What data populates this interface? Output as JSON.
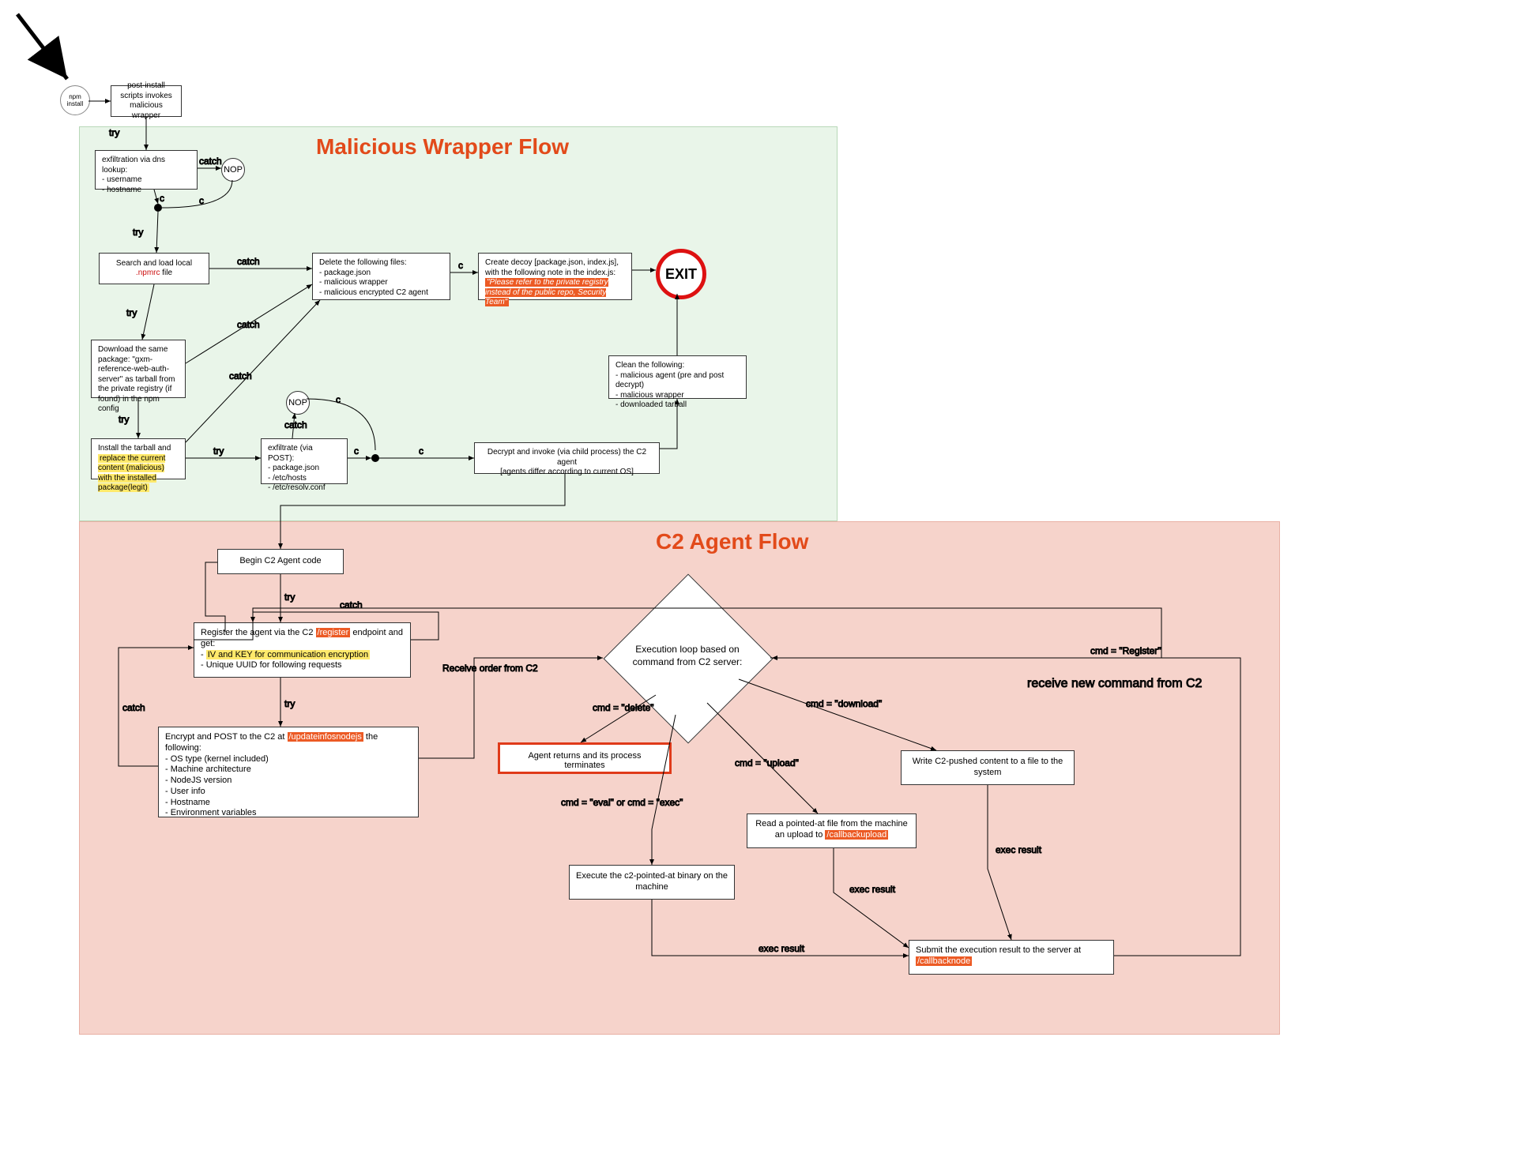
{
  "chart_data": {
    "type": "flowchart",
    "sections": [
      {
        "id": "wrapper",
        "title": "Malicious Wrapper Flow",
        "color": "#e9f5e9"
      },
      {
        "id": "c2",
        "title": "C2 Agent Flow",
        "color": "#f6d3cb"
      }
    ],
    "nodes": [
      {
        "id": "start",
        "kind": "circle",
        "label": "npm install"
      },
      {
        "id": "postinstall",
        "kind": "box",
        "label": "post-install scripts invokes malicious wrapper"
      },
      {
        "id": "exfil_dns",
        "kind": "box",
        "label": "exfiltration via dns lookup:",
        "bullets": [
          "username",
          "hostname"
        ]
      },
      {
        "id": "nop1",
        "kind": "nop",
        "label": "NOP"
      },
      {
        "id": "dot1",
        "kind": "junction"
      },
      {
        "id": "search_npmrc",
        "kind": "box",
        "label": "Search and load local",
        "highlight": ".npmrc",
        "highlight_style": "text-red",
        "suffix": " file"
      },
      {
        "id": "download_pkg",
        "kind": "box",
        "label": "Download the same package: \"gxm-reference-web-auth-server\" as tarball from the private registry (if found) in the npm config"
      },
      {
        "id": "install_tarball",
        "kind": "box",
        "label": "Install the tarball and ",
        "highlight": "replace the current content (malicious) with the installed package(legit)",
        "highlight_style": "yellow"
      },
      {
        "id": "nop2",
        "kind": "nop",
        "label": "NOP"
      },
      {
        "id": "exfil_post",
        "kind": "box",
        "label": "exfiltrate (via POST):",
        "bullets": [
          "package.json",
          "/etc/hosts",
          "/etc/resolv.conf"
        ]
      },
      {
        "id": "dot2",
        "kind": "junction"
      },
      {
        "id": "delete_files",
        "kind": "box",
        "label": "Delete the following files:",
        "bullets": [
          "package.json",
          "malicious wrapper",
          "malicious encrypted C2 agent"
        ]
      },
      {
        "id": "decoy",
        "kind": "box",
        "label": "Create decoy [package.json, index.js], with the following note in the index.js:",
        "highlight": "\"Please refer to the private registry instead of the public repo, Security Team\"",
        "highlight_style": "orange"
      },
      {
        "id": "exit",
        "kind": "exit-circle",
        "label": "EXIT"
      },
      {
        "id": "clean",
        "kind": "box",
        "label": "Clean the following:",
        "bullets": [
          "malicious agent (pre and post decrypt)",
          "malicious wrapper",
          "downloaded tarball"
        ]
      },
      {
        "id": "decrypt",
        "kind": "box",
        "label": "Decrypt and invoke (via child process) the C2 agent",
        "subnote": "[agents differ according to current OS]"
      },
      {
        "id": "begin_c2",
        "kind": "box",
        "label": "Begin C2 Agent code"
      },
      {
        "id": "register",
        "kind": "box",
        "label": "Register the agent via the C2 ",
        "inline_hl": "/register",
        "suffix": " endpoint and get:",
        "bullets_hl": [
          "IV and KEY for communication encryption"
        ],
        "bullets": [
          "Unique UUID for following requests"
        ]
      },
      {
        "id": "encrypt_post",
        "kind": "box",
        "label": "Encrypt and POST to the C2 at ",
        "inline_hl": "/updateinfosnodejs",
        "suffix": " the following:",
        "bullets": [
          "OS type (kernel included)",
          "Machine architecture",
          "NodeJS version",
          "User info",
          "Hostname",
          "Environment variables"
        ]
      },
      {
        "id": "loop",
        "kind": "diamond",
        "label": "Execution loop based on command from C2 server:"
      },
      {
        "id": "delete_cmd",
        "kind": "redbox",
        "label": "Agent returns and its process terminates"
      },
      {
        "id": "exec_cmd",
        "kind": "box",
        "label": "Execute the c2-pointed-at binary on the machine"
      },
      {
        "id": "upload_cmd",
        "kind": "box",
        "label": "Read a pointed-at file from the machine an upload to ",
        "inline_hl": "/callbackupload"
      },
      {
        "id": "download_cmd",
        "kind": "box",
        "label": "Write C2-pushed content to a file to the system"
      },
      {
        "id": "submit",
        "kind": "box",
        "label": "Submit the execution result to the server at ",
        "inline_hl": "/callbacknode"
      }
    ],
    "edges": [
      {
        "from": "start",
        "to": "postinstall"
      },
      {
        "from": "postinstall",
        "to": "exfil_dns",
        "label": "try"
      },
      {
        "from": "exfil_dns",
        "to": "nop1",
        "label": "catch"
      },
      {
        "from": "nop1",
        "to": "dot1",
        "label": "c"
      },
      {
        "from": "exfil_dns",
        "to": "dot1",
        "label": "c"
      },
      {
        "from": "dot1",
        "to": "search_npmrc",
        "label": "try"
      },
      {
        "from": "search_npmrc",
        "to": "delete_files",
        "label": "catch"
      },
      {
        "from": "search_npmrc",
        "to": "download_pkg",
        "label": "try"
      },
      {
        "from": "download_pkg",
        "to": "delete_files",
        "label": "catch"
      },
      {
        "from": "download_pkg",
        "to": "install_tarball",
        "label": "try"
      },
      {
        "from": "install_tarball",
        "to": "delete_files",
        "label": "catch"
      },
      {
        "from": "install_tarball",
        "to": "exfil_post",
        "label": "try"
      },
      {
        "from": "exfil_post",
        "to": "nop2",
        "label": "catch"
      },
      {
        "from": "nop2",
        "to": "dot2",
        "label": "c"
      },
      {
        "from": "exfil_post",
        "to": "dot2",
        "label": "c"
      },
      {
        "from": "dot2",
        "to": "decrypt",
        "label": "c"
      },
      {
        "from": "delete_files",
        "to": "decoy",
        "label": "c"
      },
      {
        "from": "decoy",
        "to": "exit",
        "label": "c"
      },
      {
        "from": "decrypt",
        "to": "clean",
        "label": ""
      },
      {
        "from": "clean",
        "to": "exit",
        "label": ""
      },
      {
        "from": "decrypt",
        "to": "begin_c2",
        "label": ""
      },
      {
        "from": "begin_c2",
        "to": "register",
        "label": "try"
      },
      {
        "from": "register",
        "to": "encrypt_post",
        "label": "try"
      },
      {
        "from": "register",
        "to": "begin_c2",
        "label": "catch (loop)"
      },
      {
        "from": "encrypt_post",
        "to": "begin_c2",
        "label": "catch (loop)"
      },
      {
        "from": "encrypt_post",
        "to": "loop",
        "label": "Receive order from C2"
      },
      {
        "from": "loop",
        "to": "delete_cmd",
        "label": "cmd = \"delete\""
      },
      {
        "from": "loop",
        "to": "exec_cmd",
        "label": "cmd = \"eval\" or cmd = \"exec\""
      },
      {
        "from": "loop",
        "to": "upload_cmd",
        "label": "cmd = \"upload\""
      },
      {
        "from": "loop",
        "to": "download_cmd",
        "label": "cmd = \"download\""
      },
      {
        "from": "loop",
        "to": "register",
        "label": "cmd = \"Register\""
      },
      {
        "from": "exec_cmd",
        "to": "submit",
        "label": "exec result"
      },
      {
        "from": "upload_cmd",
        "to": "submit",
        "label": "exec result"
      },
      {
        "from": "download_cmd",
        "to": "submit",
        "label": "exec result"
      },
      {
        "from": "submit",
        "to": "loop",
        "label": "receive new command from C2"
      }
    ]
  },
  "titles": {
    "wrapper": "Malicious Wrapper Flow",
    "c2": "C2 Agent Flow"
  },
  "start": {
    "label": "npm\ninstall"
  },
  "postinstall": {
    "text": "post-install scripts invokes malicious wrapper"
  },
  "exfil_dns": {
    "title": "exfiltration via dns lookup:",
    "b1": "- username",
    "b2": "- hostname"
  },
  "nop1": {
    "text": "NOP"
  },
  "search_npmrc": {
    "pre": "Search and load local ",
    "hl": ".npmrc",
    "post": " file"
  },
  "download_pkg": {
    "text": "Download the same package: \"gxm-reference-web-auth-server\" as tarball from the private registry (if found) in the npm config"
  },
  "install_tarball": {
    "pre": "Install the tarball and ",
    "hl": "replace the current content (malicious) with the installed package(legit)"
  },
  "nop2": {
    "text": "NOP"
  },
  "exfil_post": {
    "title": "exfiltrate (via POST):",
    "b1": "- package.json",
    "b2": "- /etc/hosts",
    "b3": "- /etc/resolv.conf"
  },
  "delete_files": {
    "title": "Delete the following files:",
    "b1": "- package.json",
    "b2": "- malicious wrapper",
    "b3": "- malicious encrypted C2 agent"
  },
  "decoy": {
    "title": "Create decoy [package.json, index.js], with the following note in the index.js:",
    "hl": "\"Please refer to the private registry instead of the public repo, Security Team\""
  },
  "exit": {
    "text": "EXIT"
  },
  "clean": {
    "title": "Clean the following:",
    "b1": "- malicious agent (pre and post decrypt)",
    "b2": "- malicious wrapper",
    "b3": "- downloaded tarball"
  },
  "decrypt": {
    "line1": "Decrypt and invoke (via child process) the C2 agent",
    "line2": "[agents differ according to current OS]"
  },
  "begin_c2": {
    "text": "Begin C2 Agent code"
  },
  "register": {
    "pre": "Register the agent via the C2 ",
    "hl": "/register",
    "mid": " endpoint and get:",
    "b1_hl": "IV and KEY for communication encryption",
    "b2": "- Unique UUID for following requests"
  },
  "encrypt_post": {
    "pre": "Encrypt and POST to the C2 at ",
    "hl": "/updateinfosnodejs",
    "mid": " the following:",
    "b1": "- OS type (kernel included)",
    "b2": "- Machine architecture",
    "b3": "- NodeJS version",
    "b4": "- User info",
    "b5": "- Hostname",
    "b6": "- Environment variables"
  },
  "loop": {
    "line1": "Execution loop based on",
    "line2": "command from C2 server:"
  },
  "delete_cmd": {
    "text": "Agent returns and its process terminates"
  },
  "exec_cmd": {
    "text": "Execute the c2-pointed-at binary on the machine"
  },
  "upload_cmd": {
    "pre": "Read a pointed-at file from the machine an upload to ",
    "hl": "/callbackupload"
  },
  "download_cmd": {
    "text": "Write C2-pushed content to a file to the system"
  },
  "submit": {
    "pre": "Submit the execution result to the server at ",
    "hl": "/callbacknode"
  },
  "edge_labels": {
    "try": "try",
    "catch": "catch",
    "c": "c",
    "recv": "Receive order from C2",
    "cmd_delete": "cmd = \"delete\"",
    "cmd_exec": "cmd = \"eval\" or cmd = \"exec\"",
    "cmd_upload": "cmd = \"upload\"",
    "cmd_download": "cmd = \"download\"",
    "cmd_register": "cmd = \"Register\"",
    "exec_result": "exec result",
    "new_cmd": "receive new command from C2"
  }
}
